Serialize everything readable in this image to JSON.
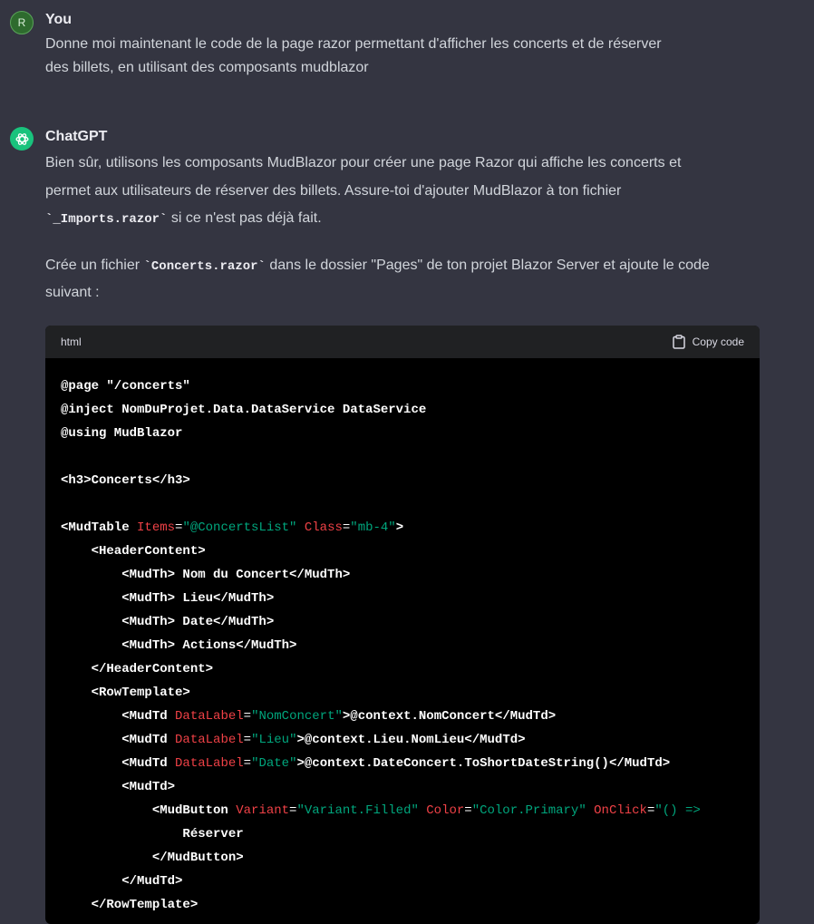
{
  "user_message": {
    "avatar_letter": "R",
    "author": "You",
    "text_line1": "Donne moi maintenant le code de la page razor permettant d'afficher les concerts et de réserver",
    "text_line2": "des billets, en utilisant des composants mudblazor"
  },
  "assistant_message": {
    "author": "ChatGPT",
    "para1_line1": "Bien sûr, utilisons les composants MudBlazor pour créer une page Razor qui affiche les concerts et",
    "para1_line2": "permet aux utilisateurs de réserver des billets. Assure-toi d'ajouter MudBlazor à ton fichier",
    "para1_code": "`_Imports.razor`",
    "para1_tail": " si ce n'est pas déjà fait.",
    "para2_head": "Crée un fichier ",
    "para2_code": "`Concerts.razor`",
    "para2_tail": " dans le dossier \"Pages\" de ton projet Blazor Server et ajoute le code",
    "para2_line2": "suivant :"
  },
  "code_block": {
    "language": "html",
    "copy_label": "Copy code",
    "lines": [
      "@page \"/concerts\"",
      "@inject NomDuProjet.Data.DataService DataService",
      "@using MudBlazor",
      "",
      "<h3>Concerts</h3>",
      "",
      "<MudTable Items=\"@ConcertsList\" Class=\"mb-4\">",
      "    <HeaderContent>",
      "        <MudTh> Nom du Concert</MudTh>",
      "        <MudTh> Lieu</MudTh>",
      "        <MudTh> Date</MudTh>",
      "        <MudTh> Actions</MudTh>",
      "    </HeaderContent>",
      "    <RowTemplate>",
      "        <MudTd DataLabel=\"NomConcert\">@context.NomConcert</MudTd>",
      "        <MudTd DataLabel=\"Lieu\">@context.Lieu.NomLieu</MudTd>",
      "        <MudTd DataLabel=\"Date\">@context.DateConcert.ToShortDateString()</MudTd>",
      "        <MudTd>",
      "            <MudButton Variant=\"Variant.Filled\" Color=\"Color.Primary\" OnClick=\"() =>",
      "                Réserver",
      "            </MudButton>",
      "        </MudTd>",
      "    </RowTemplate>"
    ]
  }
}
